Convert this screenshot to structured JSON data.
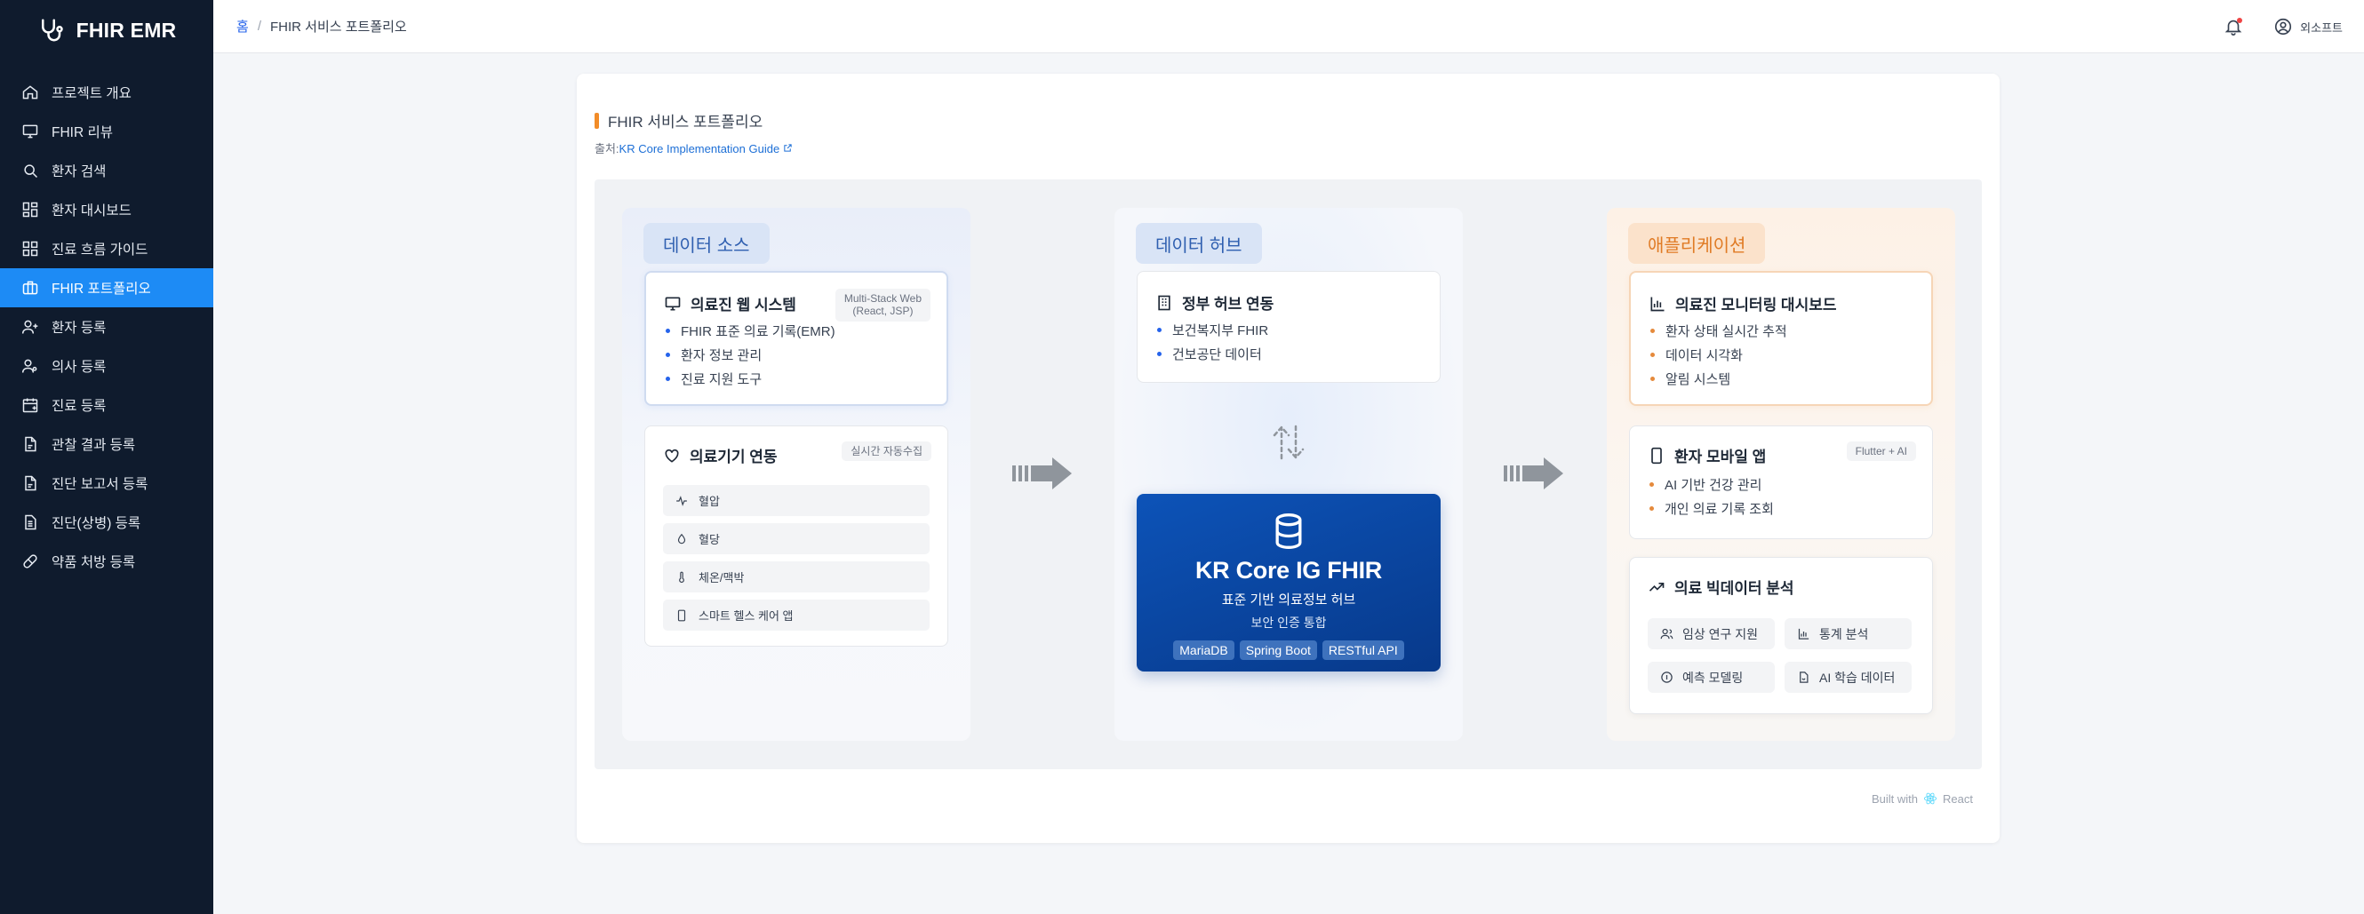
{
  "app": {
    "name": "FHIR EMR"
  },
  "sidebar": {
    "items": [
      {
        "label": "프로젝트 개요",
        "icon": "home-icon"
      },
      {
        "label": "FHIR 리뷰",
        "icon": "monitor-icon"
      },
      {
        "label": "환자 검색",
        "icon": "search-icon"
      },
      {
        "label": "환자 대시보드",
        "icon": "dashboard-grid-icon"
      },
      {
        "label": "진료 흐름 가이드",
        "icon": "flow-grid-icon"
      },
      {
        "label": "FHIR 포트폴리오",
        "icon": "briefcase-icon",
        "active": true
      },
      {
        "label": "환자 등록",
        "icon": "user-add-icon"
      },
      {
        "label": "의사 등록",
        "icon": "user-icon"
      },
      {
        "label": "진료 등록",
        "icon": "calendar-icon"
      },
      {
        "label": "관찰 결과 등록",
        "icon": "file-icon"
      },
      {
        "label": "진단 보고서 등록",
        "icon": "file-icon"
      },
      {
        "label": "진단(상병) 등록",
        "icon": "document-icon"
      },
      {
        "label": "약품 처방 등록",
        "icon": "pill-icon"
      }
    ]
  },
  "header": {
    "breadcrumb_home": "홈",
    "breadcrumb_sep": "/",
    "breadcrumb_current": "FHIR 서비스 포트폴리오",
    "user_name": "외소프트"
  },
  "page": {
    "title": "FHIR 서비스 포트폴리오",
    "source_prefix": "출처:",
    "source_link": "KR Core Implementation Guide"
  },
  "columns": {
    "source": {
      "title": "데이터 소스",
      "web": {
        "title": "의료진 웹 시스템",
        "tag_line1": "Multi-Stack Web",
        "tag_line2": "(React, JSP)",
        "items": [
          "FHIR 표준 의료 기록(EMR)",
          "환자 정보 관리",
          "진료 지원 도구"
        ]
      },
      "device": {
        "title": "의료기기 연동",
        "tag": "실시간 자동수집",
        "items": [
          "혈압",
          "혈당",
          "체온/맥박",
          "스마트 헬스 케어 앱"
        ]
      }
    },
    "hub": {
      "title": "데이터 허브",
      "gov": {
        "title": "정부 허브 연동",
        "items": [
          "보건복지부 FHIR",
          "건보공단 데이터"
        ]
      },
      "core": {
        "title": "KR Core IG FHIR",
        "subtitle": "표준 기반 의료정보 허브",
        "subtitle2": "보안 인증 통합",
        "tags": [
          "MariaDB",
          "Spring Boot",
          "RESTful API"
        ]
      }
    },
    "apps": {
      "title": "애플리케이션",
      "monitor": {
        "title": "의료진 모니터링 대시보드",
        "items": [
          "환자 상태 실시간 추적",
          "데이터 시각화",
          "알림 시스템"
        ]
      },
      "mobile": {
        "title": "환자 모바일 앱",
        "tag": "Flutter + AI",
        "items": [
          "AI 기반 건강 관리",
          "개인 의료 기록 조회"
        ]
      },
      "bigdata": {
        "title": "의료 빅데이터 분석",
        "items": [
          "임상 연구 지원",
          "통계 분석",
          "예측 모델링",
          "AI 학습 데이터"
        ]
      }
    }
  },
  "footer": {
    "built_with": "Built with",
    "framework": "React"
  },
  "colors": {
    "sidebar_bg": "#0f1b2d",
    "active": "#1d8bf5",
    "hub_blue": "#0d53b8",
    "accent_orange": "#f28c28"
  }
}
